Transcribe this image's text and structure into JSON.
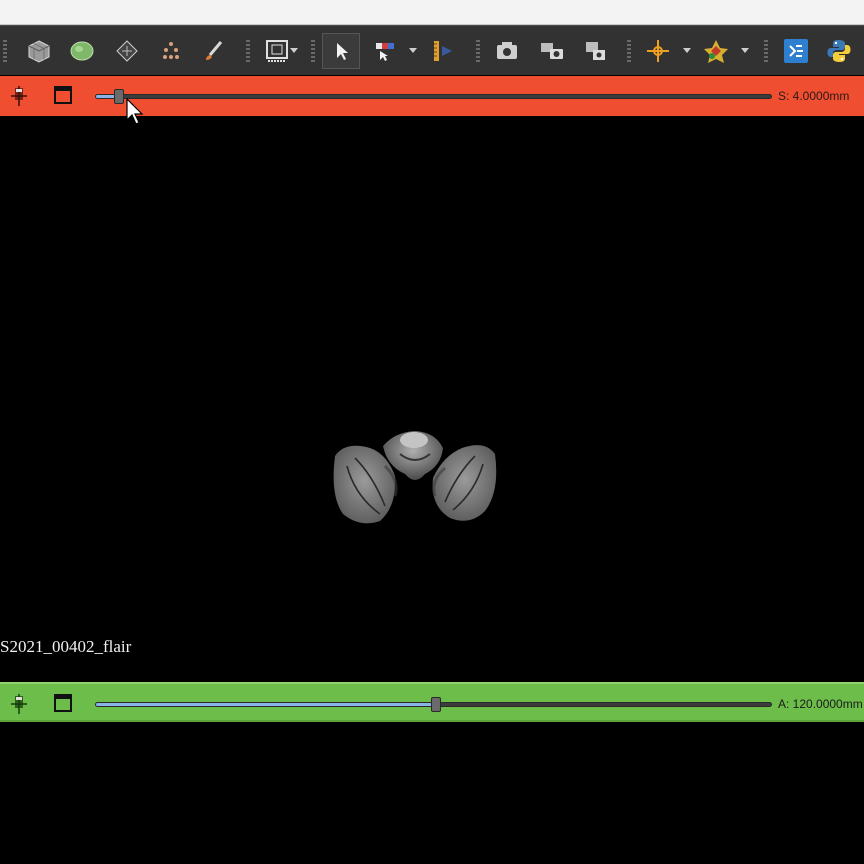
{
  "toolbar": {
    "icons": [
      "volume-cube-icon",
      "segmentation-icon",
      "models-icon",
      "markups-icon",
      "brush-icon",
      "layout-icon",
      "arrow-pointer-icon",
      "window-level-icon",
      "ruler-icon",
      "screenshot-icon",
      "capture-icon",
      "scene-view-icon",
      "crosshair-icon",
      "transform-icon",
      "extension-icon",
      "python-icon"
    ]
  },
  "red_slice": {
    "offset_label": "S: 4.0000mm",
    "slider_fraction": 0.034,
    "color": "#f04e31"
  },
  "green_slice": {
    "offset_label": "A: 120.0000mm",
    "slider_fraction": 0.504,
    "color": "#6dbd4a"
  },
  "viewer": {
    "volume_name": "S2021_00402_flair"
  }
}
